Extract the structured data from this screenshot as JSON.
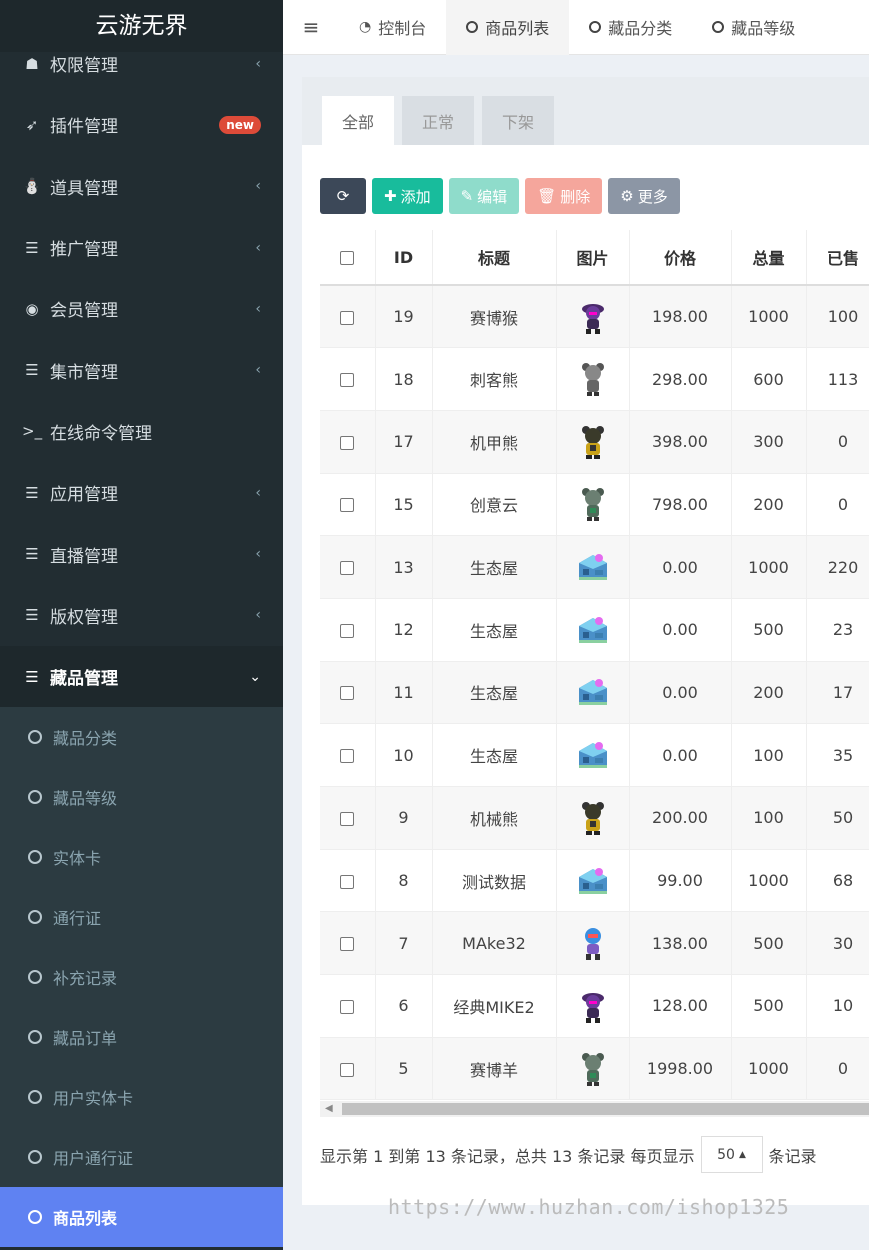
{
  "app": {
    "title": "云游无界"
  },
  "sidebar": {
    "partial_item": {
      "label": "权限管理"
    },
    "items": [
      {
        "label": "插件管理",
        "badge": "new"
      },
      {
        "label": "道具管理"
      },
      {
        "label": "推广管理"
      },
      {
        "label": "会员管理"
      },
      {
        "label": "集市管理"
      },
      {
        "label": "在线命令管理"
      },
      {
        "label": "应用管理"
      },
      {
        "label": "直播管理"
      },
      {
        "label": "版权管理"
      }
    ],
    "open_item": {
      "label": "藏品管理"
    },
    "sub_items": [
      {
        "label": "藏品分类"
      },
      {
        "label": "藏品等级"
      },
      {
        "label": "实体卡"
      },
      {
        "label": "通行证"
      },
      {
        "label": "补充记录"
      },
      {
        "label": "藏品订单"
      },
      {
        "label": "用户实体卡"
      },
      {
        "label": "用户通行证"
      },
      {
        "label": "商品列表"
      }
    ]
  },
  "topbar": {
    "tabs": [
      {
        "label": "控制台"
      },
      {
        "label": "商品列表"
      },
      {
        "label": "藏品分类"
      },
      {
        "label": "藏品等级"
      }
    ]
  },
  "subtabs": [
    {
      "label": "全部"
    },
    {
      "label": "正常"
    },
    {
      "label": "下架"
    }
  ],
  "toolbar": {
    "add": "添加",
    "edit": "编辑",
    "delete": "删除",
    "more": "更多"
  },
  "table": {
    "headers": {
      "id": "ID",
      "title": "标题",
      "image": "图片",
      "price": "价格",
      "total": "总量",
      "sold": "已售"
    },
    "rows": [
      {
        "id": "19",
        "title": "赛博猴",
        "price": "198.00",
        "total": "1000",
        "sold": "100",
        "img": "robot-purple"
      },
      {
        "id": "18",
        "title": "刺客熊",
        "price": "298.00",
        "total": "600",
        "sold": "113",
        "img": "bear-grey"
      },
      {
        "id": "17",
        "title": "机甲熊",
        "price": "398.00",
        "total": "300",
        "sold": "0",
        "img": "bear-yellow"
      },
      {
        "id": "15",
        "title": "创意云",
        "price": "798.00",
        "total": "200",
        "sold": "0",
        "img": "bear-green"
      },
      {
        "id": "13",
        "title": "生态屋",
        "price": "0.00",
        "total": "1000",
        "sold": "220",
        "img": "house-blue"
      },
      {
        "id": "12",
        "title": "生态屋",
        "price": "0.00",
        "total": "500",
        "sold": "23",
        "img": "house-blue"
      },
      {
        "id": "11",
        "title": "生态屋",
        "price": "0.00",
        "total": "200",
        "sold": "17",
        "img": "house-blue"
      },
      {
        "id": "10",
        "title": "生态屋",
        "price": "0.00",
        "total": "100",
        "sold": "35",
        "img": "house-blue"
      },
      {
        "id": "9",
        "title": "机械熊",
        "price": "200.00",
        "total": "100",
        "sold": "50",
        "img": "bear-yellow"
      },
      {
        "id": "8",
        "title": "测试数据",
        "price": "99.00",
        "total": "1000",
        "sold": "68",
        "img": "house-blue"
      },
      {
        "id": "7",
        "title": "MAke32",
        "price": "138.00",
        "total": "500",
        "sold": "30",
        "img": "robot-blue"
      },
      {
        "id": "6",
        "title": "经典MIKE2",
        "price": "128.00",
        "total": "500",
        "sold": "10",
        "img": "robot-purple"
      },
      {
        "id": "5",
        "title": "赛博羊",
        "price": "1998.00",
        "total": "1000",
        "sold": "0",
        "img": "bear-green"
      }
    ]
  },
  "pager": {
    "summary": "显示第 1 到第 13 条记录，总共 13 条记录 每页显示",
    "page_size": "50",
    "suffix": "条记录"
  },
  "watermark": "https://www.huzhan.com/ishop1325",
  "colors": {
    "sidebar_bg": "#222d32",
    "active_item": "#5f82f2",
    "add": "#18bc9c",
    "delete": "#f5a69c",
    "new_badge": "#dd4b39"
  }
}
